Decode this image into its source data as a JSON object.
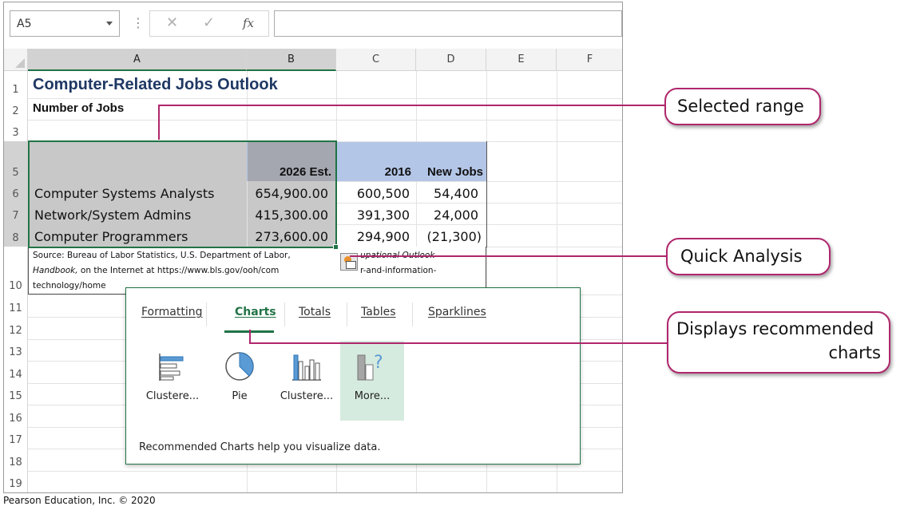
{
  "formula_bar": {
    "name_box": "A5",
    "cancel_glyph": "✕",
    "enter_glyph": "✓",
    "fx_label": "fx",
    "formula": ""
  },
  "columns": [
    "A",
    "B",
    "C",
    "D",
    "E",
    "F"
  ],
  "rows": [
    "1",
    "2",
    "3",
    "5",
    "6",
    "7",
    "8",
    "10",
    "11",
    "12",
    "13",
    "14",
    "15",
    "16",
    "17",
    "18",
    "19"
  ],
  "sheet": {
    "title": "Computer-Related Jobs Outlook",
    "subtitle": "Number of Jobs",
    "headers": [
      "2026 Est.",
      "2016",
      "New Jobs"
    ],
    "data_rows": [
      {
        "job": "Computer Systems Analysts",
        "est2026": "654,900.00",
        "y2016": "600,500",
        "new": "54,400"
      },
      {
        "job": "Network/System Admins",
        "est2026": "415,300.00",
        "y2016": "391,300",
        "new": "24,000"
      },
      {
        "job": "Computer Programmers",
        "est2026": "273,600.00",
        "y2016": "294,900",
        "new": "(21,300)"
      }
    ],
    "source_line1": "Source: Bureau of Labor Statistics, U.S. Department of Labor,",
    "source_line1_tail": "upational Outlook",
    "source_line2_italic": "Handbook,",
    "source_line2": " on the Internet at https://www.bls.gov/ooh/com",
    "source_line2_tail": "r-and-information-",
    "source_line3": "technology/home"
  },
  "quick_analysis": {
    "tabs": [
      "Formatting",
      "Charts",
      "Totals",
      "Tables",
      "Sparklines"
    ],
    "active_tab": "Charts",
    "tiles": [
      {
        "label": "Clustere...",
        "icon": "clustered-bar-chart-icon"
      },
      {
        "label": "Pie",
        "icon": "pie-chart-icon"
      },
      {
        "label": "Clustere...",
        "icon": "clustered-column-chart-icon"
      },
      {
        "label": "More...",
        "icon": "more-charts-icon"
      }
    ],
    "footer": "Recommended Charts help you visualize data."
  },
  "callouts": {
    "selected_range": "Selected range",
    "quick_analysis": "Quick Analysis",
    "recommended_1": "Displays recommended",
    "recommended_2": "charts"
  },
  "credit": "Pearson Education, Inc. © 2020",
  "colors": {
    "accent_green": "#217346",
    "header_blue_fill": "#b4c6e7",
    "selection_gray": "#c8c8c8",
    "title_navy": "#1f3864",
    "callout_magenta": "#b0266d"
  }
}
